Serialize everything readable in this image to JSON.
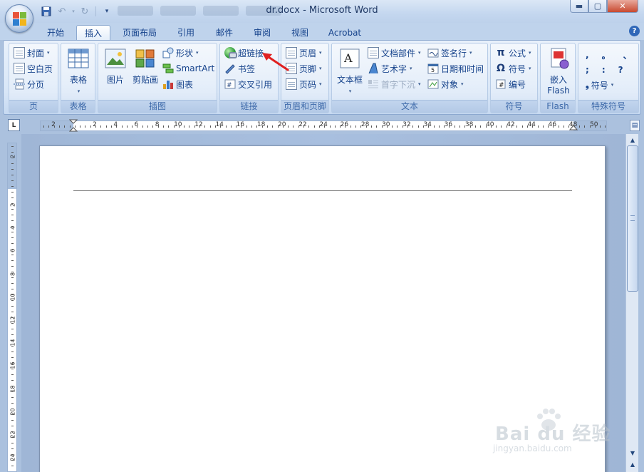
{
  "window": {
    "title": "dr.docx - Microsoft Word"
  },
  "tabs": [
    "开始",
    "插入",
    "页面布局",
    "引用",
    "邮件",
    "审阅",
    "视图",
    "Acrobat"
  ],
  "active_tab": "插入",
  "groups": {
    "page": {
      "label": "页",
      "items": [
        "封面",
        "空白页",
        "分页"
      ]
    },
    "table": {
      "label": "表格",
      "button": "表格"
    },
    "illustrations": {
      "label": "插图",
      "picture": "图片",
      "clipart": "剪贴画",
      "shapes": "形状",
      "smartart": "SmartArt",
      "chart": "图表"
    },
    "links": {
      "label": "链接",
      "hyperlink": "超链接",
      "bookmark": "书签",
      "crossref": "交叉引用"
    },
    "header_footer": {
      "label": "页眉和页脚",
      "header": "页眉",
      "footer": "页脚",
      "page_number": "页码"
    },
    "text": {
      "label": "文本",
      "textbox": "文本框",
      "quickparts": "文档部件",
      "wordart": "艺术字",
      "dropcap": "首字下沉",
      "signature": "签名行",
      "datetime": "日期和时间",
      "object": "对象"
    },
    "symbols": {
      "label": "符号",
      "equation": "公式",
      "symbol": "符号",
      "number": "编号"
    },
    "flash": {
      "label": "Flash",
      "embed": "嵌入",
      "embed2": "Flash"
    },
    "special": {
      "label": "特殊符号",
      "symbol": "符号",
      "chars": [
        ",",
        "。",
        "、",
        ";",
        ":",
        "?"
      ]
    }
  },
  "ruler": {
    "ticks": [
      "2",
      "2",
      "4",
      "6",
      "8",
      "10",
      "12",
      "14",
      "16",
      "18",
      "20",
      "22",
      "24",
      "26",
      "28",
      "30",
      "32",
      "34",
      "36",
      "38",
      "40",
      "42",
      "44",
      "46",
      "48",
      "50"
    ]
  },
  "vruler": {
    "ticks": [
      "2",
      "2",
      "4",
      "6",
      "8",
      "10",
      "12",
      "14",
      "16",
      "18",
      "20",
      "22",
      "24"
    ]
  },
  "tab_selector": "L",
  "watermark": {
    "brand": "Bai du 经验",
    "url": "jingyan.baidu.com"
  },
  "colors": {
    "accent": "#15428b",
    "annotation_arrow": "#e02020"
  }
}
